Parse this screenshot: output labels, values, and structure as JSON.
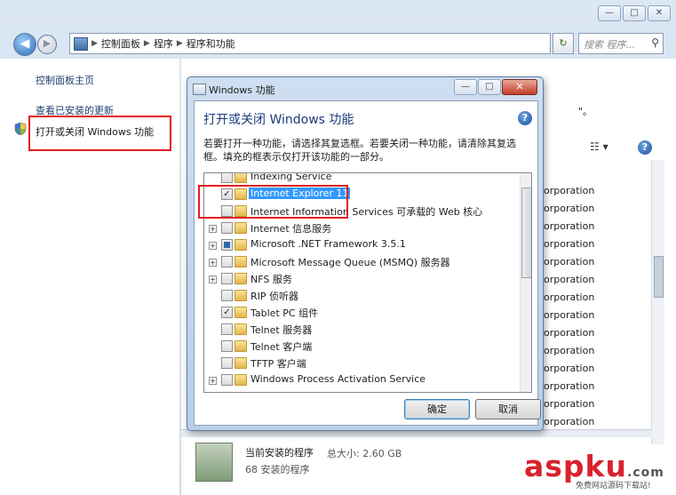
{
  "window": {
    "controls": [
      "—",
      "□",
      "✕"
    ]
  },
  "navbar": {
    "breadcrumb": [
      "控制面板",
      "程序",
      "程序和功能"
    ],
    "search_placeholder": "搜索 程序...",
    "refresh": "↻"
  },
  "left_pane": {
    "links": [
      "控制面板主页",
      "查看已安装的更新",
      "打开或关闭 Windows 功能"
    ]
  },
  "main": {
    "quote_fragment": "\"。",
    "publisher_rows": [
      "orporation",
      "orporation",
      "orporation",
      "orporation",
      "orporation",
      "orporation",
      "orporation",
      "orporation",
      "orporation",
      "orporation",
      "orporation",
      "orporation",
      "orporation",
      "orporation"
    ],
    "bottom": {
      "title": "当前安装的程序",
      "size_label": "总大小: 2.60 GB",
      "count": "68 安装的程序"
    }
  },
  "dialog": {
    "title": "Windows 功能",
    "heading": "打开或关闭 Windows 功能",
    "description": "若要打开一种功能，请选择其复选框。若要关闭一种功能，请清除其复选框。填充的框表示仅打开该功能的一部分。",
    "features": [
      {
        "label": "Indexing Service",
        "expand": false,
        "state": "unchecked",
        "selected": false
      },
      {
        "label": "Internet Explorer 11",
        "expand": false,
        "state": "checked",
        "selected": true
      },
      {
        "label": "Internet Information Services 可承载的 Web 核心",
        "expand": false,
        "state": "unchecked",
        "selected": false
      },
      {
        "label": "Internet 信息服务",
        "expand": true,
        "state": "unchecked",
        "selected": false
      },
      {
        "label": "Microsoft .NET Framework 3.5.1",
        "expand": true,
        "state": "partial",
        "selected": false
      },
      {
        "label": "Microsoft Message Queue (MSMQ) 服务器",
        "expand": true,
        "state": "unchecked",
        "selected": false
      },
      {
        "label": "NFS 服务",
        "expand": true,
        "state": "unchecked",
        "selected": false
      },
      {
        "label": "RIP 侦听器",
        "expand": false,
        "state": "unchecked",
        "selected": false
      },
      {
        "label": "Tablet PC 组件",
        "expand": false,
        "state": "checked",
        "selected": false
      },
      {
        "label": "Telnet 服务器",
        "expand": false,
        "state": "unchecked",
        "selected": false
      },
      {
        "label": "Telnet 客户端",
        "expand": false,
        "state": "unchecked",
        "selected": false
      },
      {
        "label": "TFTP 客户端",
        "expand": false,
        "state": "unchecked",
        "selected": false
      },
      {
        "label": "Windows Process Activation Service",
        "expand": true,
        "state": "unchecked",
        "selected": false
      }
    ],
    "ok_label": "确定",
    "cancel_label": "取消"
  },
  "watermark": {
    "text_a": "asp",
    "text_b": "ku",
    "text_c": ".com",
    "sub": "免费网站源码下载站!"
  },
  "colors": {
    "highlight_box": "#e51c23",
    "selection": "#3399ff",
    "link": "#1e3f6e"
  }
}
